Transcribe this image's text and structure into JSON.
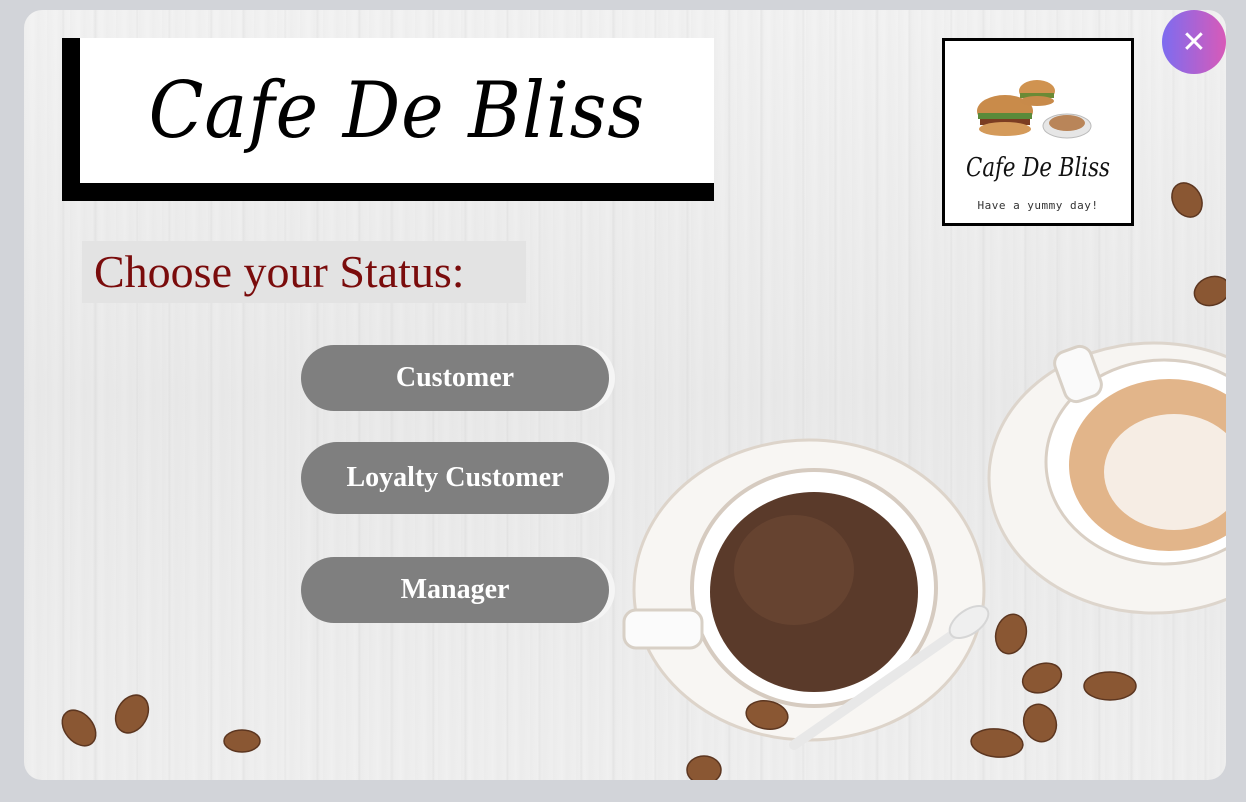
{
  "header": {
    "title": "Cafe De Bliss"
  },
  "prompt": {
    "label": "Choose your Status:"
  },
  "buttons": {
    "customer": "Customer",
    "loyalty": "Loyalty Customer",
    "manager": "Manager"
  },
  "logo": {
    "name": "Cafe De Bliss",
    "tagline": "Have a yummy day!"
  },
  "window": {
    "close_glyph": "✕"
  },
  "colors": {
    "button": "#7f7f7f",
    "prompt_text": "#7a0c0c",
    "close_gradient_start": "#7d6cf0",
    "close_gradient_end": "#d85ab8"
  },
  "icons": [
    "close-icon",
    "coffee-cup-illustration",
    "cappuccino-illustration",
    "coffee-bean-icon",
    "burger-icon"
  ]
}
